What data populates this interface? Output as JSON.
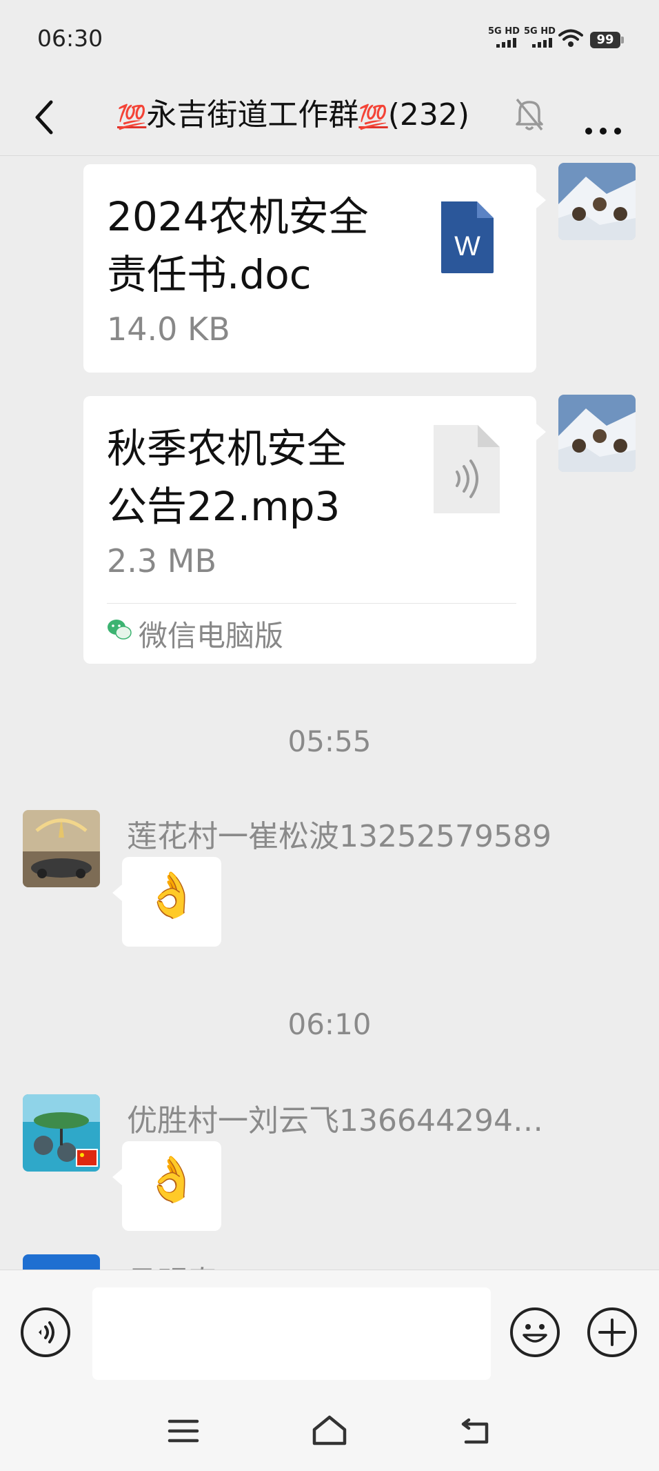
{
  "status_bar": {
    "time": "06:30",
    "signal1_label": "5G HD",
    "signal2_label": "5G HD",
    "battery": "99",
    "icons": [
      "signal-icon",
      "signal-icon",
      "wifi-icon",
      "battery-icon"
    ]
  },
  "nav": {
    "back_icon": "chevron-left-icon",
    "title_emoji": "💯",
    "title_text": "永吉街道工作群",
    "member_count": "(232)",
    "mute_icon": "bell-off-icon",
    "more_icon": "more-horizontal-icon"
  },
  "messages": {
    "file1": {
      "name_line1": "2024农机安全",
      "name_line2": "责任书.doc",
      "size": "14.0 KB",
      "icon": "word-doc-icon",
      "icon_letter": "W",
      "icon_color": "#2b579a"
    },
    "file2": {
      "name_line1": "秋季农机安全",
      "name_line2": "公告22.mp3",
      "size": "2.3 MB",
      "icon": "audio-file-icon",
      "source_label": "微信电脑版",
      "source_icon": "wechat-icon"
    },
    "time1": "05:55",
    "msg3": {
      "sender": "莲花村一崔松波13252579589",
      "content_emoji": "👌"
    },
    "time2": "06:10",
    "msg4": {
      "sender": "优胜村一刘云飞136644294…",
      "content_emoji": "👌"
    },
    "msg5": {
      "sender_partial": "吕明春"
    }
  },
  "input_bar": {
    "voice_icon": "voice-icon",
    "emoji_icon": "smiley-icon",
    "plus_icon": "plus-icon",
    "input_value": ""
  },
  "system_nav": {
    "menu_icon": "menu-icon",
    "home_icon": "home-icon",
    "back_icon": "back-icon"
  },
  "colors": {
    "background": "#ededed",
    "bubble": "#ffffff",
    "wechat_green": "#07c160",
    "word_blue": "#2b579a"
  }
}
